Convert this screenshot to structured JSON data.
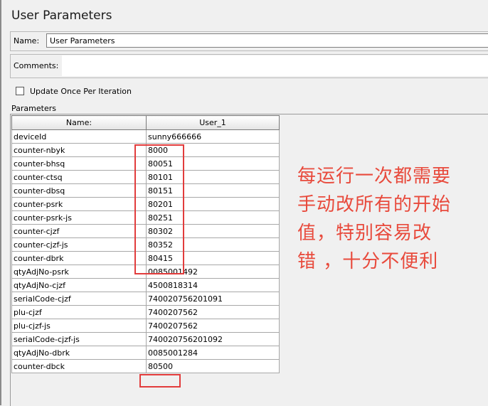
{
  "panel": {
    "title": "User Parameters"
  },
  "name_field": {
    "label": "Name:",
    "value": "User Parameters"
  },
  "comments_field": {
    "label": "Comments:",
    "value": ""
  },
  "update_checkbox": {
    "label": "Update Once Per Iteration",
    "checked": false
  },
  "parameters": {
    "section_label": "Parameters",
    "columns": [
      "Name:",
      "User_1"
    ],
    "rows": [
      [
        "deviceId",
        "sunny666666"
      ],
      [
        "counter-nbyk",
        "8000"
      ],
      [
        "counter-bhsq",
        "80051"
      ],
      [
        "counter-ctsq",
        "80101"
      ],
      [
        "counter-dbsq",
        "80151"
      ],
      [
        "counter-psrk",
        "80201"
      ],
      [
        "counter-psrk-js",
        "80251"
      ],
      [
        "counter-cjzf",
        "80302"
      ],
      [
        "counter-cjzf-js",
        "80352"
      ],
      [
        "counter-dbrk",
        "80415"
      ],
      [
        "qtyAdjNo-psrk",
        "0085001492"
      ],
      [
        "qtyAdjNo-cjzf",
        "4500818314"
      ],
      [
        "serialCode-cjzf",
        "740020756201091"
      ],
      [
        "plu-cjzf",
        "7400207562"
      ],
      [
        "plu-cjzf-js",
        "7400207562"
      ],
      [
        "serialCode-cjzf-js",
        "740020756201092"
      ],
      [
        "qtyAdjNo-dbrk",
        "0085001284"
      ],
      [
        "counter-dbck",
        "80500"
      ]
    ]
  },
  "annotation": {
    "lines": [
      "每运行一次都需要",
      "手动改所有的开始",
      "值，特别容易改",
      "错 ，十分不便利"
    ],
    "color": "#e84a3c"
  },
  "highlight_color": "#e23c3c"
}
